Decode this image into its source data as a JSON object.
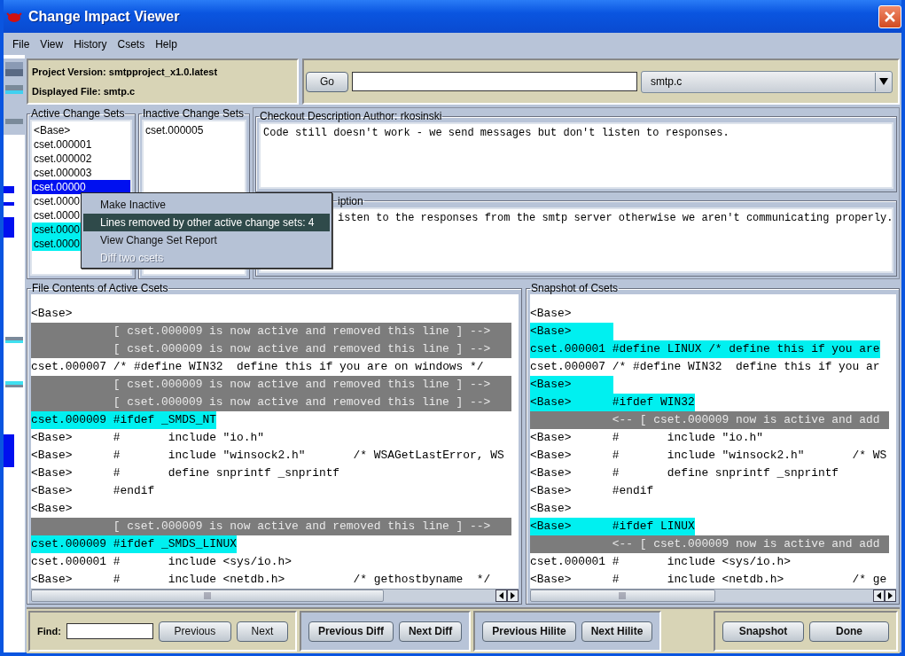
{
  "window": {
    "title": "Change Impact Viewer"
  },
  "menu": [
    "File",
    "View",
    "History",
    "Csets",
    "Help"
  ],
  "project": {
    "version_label": "Project Version: smtpproject_x1.0.latest",
    "file_label": "Displayed File: smtp.c"
  },
  "go_button": "Go",
  "file_combo": {
    "value": "smtp.c"
  },
  "active_change_sets": {
    "title": "Active Change Sets",
    "items": [
      {
        "label": "<Base>",
        "selected": false,
        "highlighted": false
      },
      {
        "label": "cset.000001",
        "selected": false,
        "highlighted": false
      },
      {
        "label": "cset.000002",
        "selected": false,
        "highlighted": false
      },
      {
        "label": "cset.000003",
        "selected": false,
        "highlighted": false
      },
      {
        "label": "cset.00000",
        "selected": true,
        "highlighted": false
      },
      {
        "label": "cset.0000",
        "selected": false,
        "highlighted": false
      },
      {
        "label": "cset.0000",
        "selected": false,
        "highlighted": false
      },
      {
        "label": "cset.0000",
        "selected": false,
        "highlighted": true
      },
      {
        "label": "cset.0000",
        "selected": false,
        "highlighted": true
      }
    ]
  },
  "inactive_change_sets": {
    "title": "Inactive Change Sets",
    "items": [
      {
        "label": "cset.000005",
        "selected": false,
        "highlighted": false
      }
    ]
  },
  "checkout": {
    "title": "Checkout Description  Author: rkosinski",
    "text": "Code still doesn't work - we send messages but don't listen to responses."
  },
  "checkin": {
    "title": "iption",
    "text": "isten to the responses from the smtp server otherwise we aren't communicating properly."
  },
  "context_menu": {
    "items": [
      {
        "label": "Make Inactive",
        "selected": false,
        "disabled": false
      },
      {
        "label": "Lines removed by other active change sets: 4",
        "selected": true,
        "disabled": false
      },
      {
        "label": "View Change Set Report",
        "selected": false,
        "disabled": false
      },
      {
        "label": "Diff two csets",
        "selected": false,
        "disabled": true
      }
    ]
  },
  "file_contents": {
    "title": "File Contents of Active Csets",
    "lines": [
      {
        "kind": "plain",
        "text": "<Base>"
      },
      {
        "kind": "removed",
        "text": "[ cset.000009 is now active and removed this line ] -->"
      },
      {
        "kind": "removed",
        "text": "[ cset.000009 is now active and removed this line ] -->"
      },
      {
        "kind": "plain",
        "text": "cset.000007 /* #define WIN32  define this if you are on windows */"
      },
      {
        "kind": "removed",
        "text": "[ cset.000009 is now active and removed this line ] -->"
      },
      {
        "kind": "removed",
        "text": "[ cset.000009 is now active and removed this line ] -->"
      },
      {
        "kind": "added",
        "text": "cset.000009 #ifdef _SMDS_NT"
      },
      {
        "kind": "plain",
        "text": "<Base>      #       include \"io.h\""
      },
      {
        "kind": "plain",
        "text": "<Base>      #       include \"winsock2.h\"       /* WSAGetLastError, WS"
      },
      {
        "kind": "plain",
        "text": "<Base>      #       define snprintf _snprintf"
      },
      {
        "kind": "plain",
        "text": "<Base>      #endif"
      },
      {
        "kind": "plain",
        "text": "<Base>"
      },
      {
        "kind": "removed",
        "text": "[ cset.000009 is now active and removed this line ] -->"
      },
      {
        "kind": "added",
        "text": "cset.000009 #ifdef _SMDS_LINUX"
      },
      {
        "kind": "plain",
        "text": "cset.000001 #       include <sys/io.h>"
      },
      {
        "kind": "plain",
        "text": "<Base>      #       include <netdb.h>          /* gethostbyname  */"
      }
    ]
  },
  "snapshot": {
    "title": "Snapshot of Csets",
    "lines": [
      {
        "kind": "plain",
        "text": "<Base>"
      },
      {
        "kind": "added",
        "text": "<Base>"
      },
      {
        "kind": "added",
        "text": "cset.000001 #define LINUX /* define this if you are"
      },
      {
        "kind": "plain",
        "text": "cset.000007 /* #define WIN32  define this if you ar"
      },
      {
        "kind": "added",
        "text": "<Base>"
      },
      {
        "kind": "added",
        "text": "<Base>      #ifdef WIN32"
      },
      {
        "kind": "removed",
        "text": "<-- [ cset.000009 now is active and add"
      },
      {
        "kind": "plain",
        "text": "<Base>      #       include \"io.h\""
      },
      {
        "kind": "plain",
        "text": "<Base>      #       include \"winsock2.h\"       /* WS"
      },
      {
        "kind": "plain",
        "text": "<Base>      #       define snprintf _snprintf"
      },
      {
        "kind": "plain",
        "text": "<Base>      #endif"
      },
      {
        "kind": "plain",
        "text": "<Base>"
      },
      {
        "kind": "added",
        "text": "<Base>      #ifdef LINUX"
      },
      {
        "kind": "removed",
        "text": "<-- [ cset.000009 now is active and add"
      },
      {
        "kind": "plain",
        "text": "cset.000001 #       include <sys/io.h>"
      },
      {
        "kind": "plain",
        "text": "<Base>      #       include <netdb.h>          /* ge"
      }
    ]
  },
  "find": {
    "label": "Find:",
    "buttons": [
      "Previous",
      "Next"
    ]
  },
  "diff_buttons": [
    "Previous Diff",
    "Next Diff"
  ],
  "hilite_buttons": [
    "Previous Hilite",
    "Next Hilite"
  ],
  "action_buttons": [
    "Snapshot",
    "Done"
  ]
}
